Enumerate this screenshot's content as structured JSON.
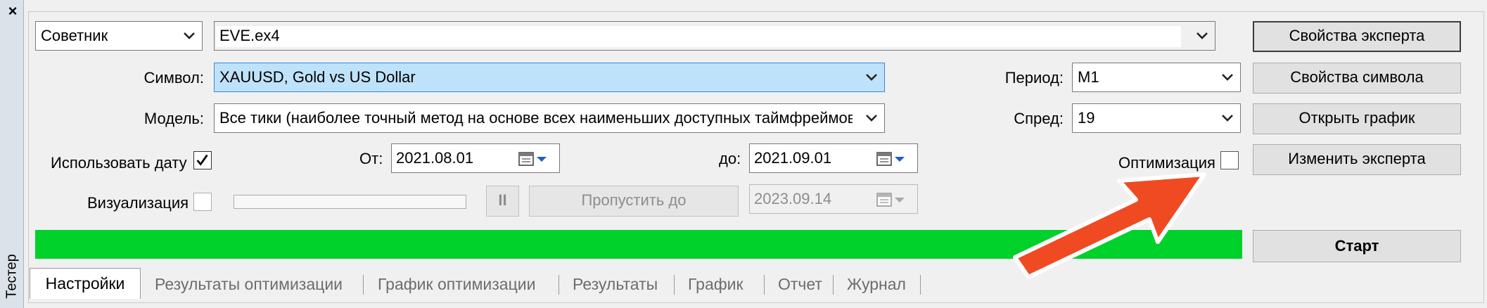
{
  "window": {
    "close_glyph": "×",
    "vertical_title": "Тестер"
  },
  "row1": {
    "type_value": "Советник",
    "expert_value": "EVE.ex4",
    "expert_props_label": "Свойства эксперта"
  },
  "row2": {
    "symbol_label": "Символ:",
    "symbol_value": "XAUUSD, Gold vs US Dollar",
    "period_label": "Период:",
    "period_value": "M1",
    "symbol_props_label": "Свойства символа"
  },
  "row3": {
    "model_label": "Модель:",
    "model_value": "Все тики (наиболее точный метод на основе всех наименьших доступных таймфреймов д",
    "spread_label": "Спред:",
    "spread_value": "19",
    "open_chart_label": "Открыть график"
  },
  "row4": {
    "use_date_label": "Использовать дату",
    "use_date_checked": true,
    "from_label": "От:",
    "from_value": "2021.08.01",
    "to_label": "до:",
    "to_value": "2021.09.01",
    "optimization_label": "Оптимизация",
    "optimization_checked": false,
    "modify_expert_label": "Изменить эксперта"
  },
  "row5": {
    "visualization_label": "Визуализация",
    "visualization_checked": false,
    "pause_glyph": "II",
    "skip_to_label": "Пропустить до",
    "skip_to_value": "2023.09.14"
  },
  "row6": {
    "progress_fraction": 1.0,
    "progress_color": "#00d12b",
    "start_label": "Старт"
  },
  "tabs": [
    {
      "label": "Настройки",
      "active": true
    },
    {
      "label": "Результаты оптимизации",
      "active": false
    },
    {
      "label": "График оптимизации",
      "active": false
    },
    {
      "label": "Результаты",
      "active": false
    },
    {
      "label": "График",
      "active": false
    },
    {
      "label": "Отчет",
      "active": false
    },
    {
      "label": "Журнал",
      "active": false
    }
  ],
  "annotation": {
    "arrow_color": "#f04a23"
  }
}
